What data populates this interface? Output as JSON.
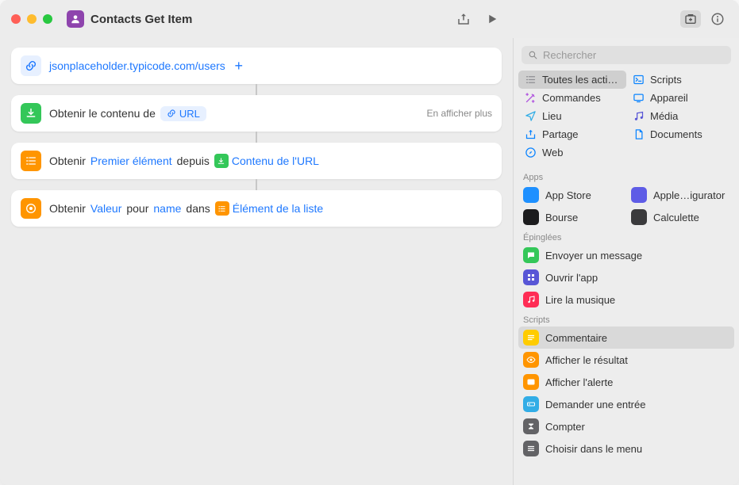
{
  "title": "Contacts Get Item",
  "search_placeholder": "Rechercher",
  "actions": {
    "url": {
      "text": "jsonplaceholder.typicode.com/users"
    },
    "get_contents": {
      "label": "Obtenir le contenu de",
      "param": "URL",
      "more": "En afficher plus"
    },
    "get_item": {
      "label": "Obtenir",
      "which": "Premier élément",
      "from": "depuis",
      "src": "Contenu de l'URL"
    },
    "get_value": {
      "label": "Obtenir",
      "what": "Valeur",
      "for": "pour",
      "key": "name",
      "in": "dans",
      "src": "Élément de la liste"
    }
  },
  "categories": [
    [
      {
        "icon": "list",
        "label": "Toutes les acti…",
        "selected": true,
        "color": "c-gray"
      },
      {
        "icon": "script",
        "label": "Scripts",
        "color": "c-blue"
      }
    ],
    [
      {
        "icon": "wand",
        "label": "Commandes",
        "color": "c-purple"
      },
      {
        "icon": "device",
        "label": "Appareil",
        "color": "c-blue"
      }
    ],
    [
      {
        "icon": "location",
        "label": "Lieu",
        "color": "c-teal"
      },
      {
        "icon": "music",
        "label": "Média",
        "color": "c-indigo"
      }
    ],
    [
      {
        "icon": "share",
        "label": "Partage",
        "color": "c-blue"
      },
      {
        "icon": "doc",
        "label": "Documents",
        "color": "c-blue"
      }
    ],
    [
      {
        "icon": "safari",
        "label": "Web",
        "color": "c-blue"
      },
      null
    ]
  ],
  "section_apps": "Apps",
  "apps": [
    {
      "label": "App Store",
      "bg": "bg-appstore"
    },
    {
      "label": "Apple…igurator",
      "bg": "bg-config"
    },
    {
      "label": "Bourse",
      "bg": "bg-dark"
    },
    {
      "label": "Calculette",
      "bg": "bg-calc"
    }
  ],
  "section_pinned": "Épinglées",
  "pinned": [
    {
      "label": "Envoyer un message",
      "bg": "bg-messages",
      "icon": "message"
    },
    {
      "label": "Ouvrir l'app",
      "bg": "bg-purple",
      "icon": "grid"
    },
    {
      "label": "Lire la musique",
      "bg": "bg-red",
      "icon": "music"
    }
  ],
  "section_scripts": "Scripts",
  "scripts": [
    {
      "label": "Commentaire",
      "bg": "bg-yellow",
      "icon": "lines",
      "selected": true
    },
    {
      "label": "Afficher le résultat",
      "bg": "bg-orange",
      "icon": "eye"
    },
    {
      "label": "Afficher l'alerte",
      "bg": "bg-orange",
      "icon": "alert"
    },
    {
      "label": "Demander une entrée",
      "bg": "bg-cyan",
      "icon": "input"
    },
    {
      "label": "Compter",
      "bg": "bg-gray",
      "icon": "sigma"
    },
    {
      "label": "Choisir dans le menu",
      "bg": "bg-gray",
      "icon": "menu"
    }
  ]
}
